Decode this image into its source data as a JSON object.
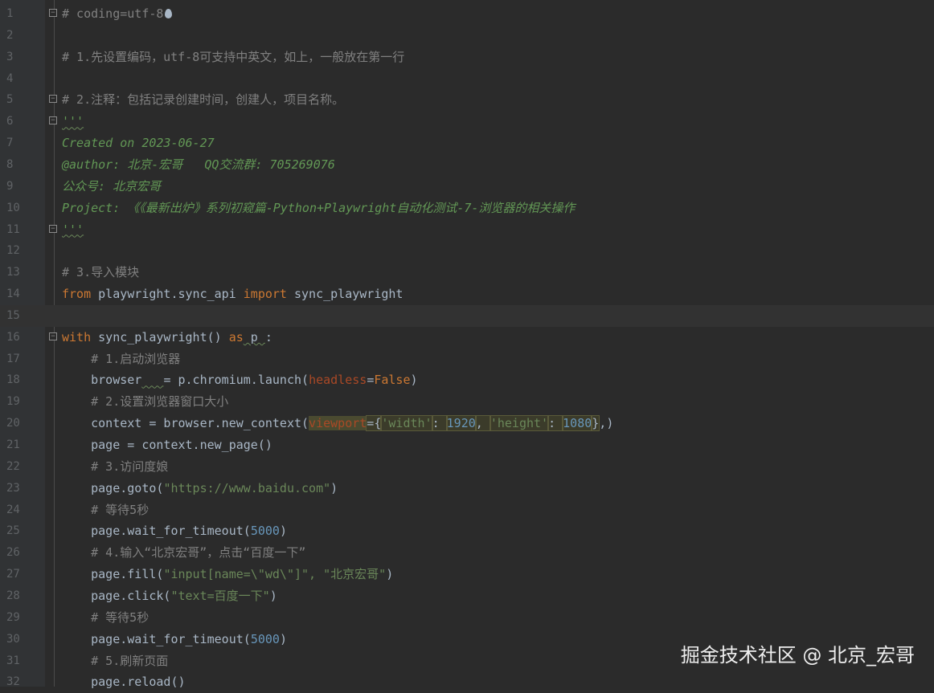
{
  "editor": {
    "lines": [
      {
        "n": "1",
        "segs": [
          [
            "t-comment",
            "# coding=utf-8"
          ]
        ],
        "fold": true,
        "drop": true
      },
      {
        "n": "2",
        "segs": []
      },
      {
        "n": "3",
        "segs": [
          [
            "t-comment",
            "# 1.先设置编码，utf-8可支持中英文，如上，一般放在第一行"
          ]
        ]
      },
      {
        "n": "4",
        "segs": []
      },
      {
        "n": "5",
        "segs": [
          [
            "t-comment",
            "# 2.注释：包括记录创建时间，创建人，项目名称。"
          ]
        ],
        "fold": true
      },
      {
        "n": "6",
        "segs": [
          [
            "t-doc squig",
            "'''"
          ]
        ],
        "fold": true
      },
      {
        "n": "7",
        "segs": [
          [
            "t-doc",
            "Created on 2023-06-27"
          ]
        ]
      },
      {
        "n": "8",
        "segs": [
          [
            "t-doc",
            "@author: 北京-宏哥   QQ交流群: 705269076"
          ]
        ]
      },
      {
        "n": "9",
        "segs": [
          [
            "t-doc",
            "公众号: 北京宏哥"
          ]
        ]
      },
      {
        "n": "10",
        "segs": [
          [
            "t-doc",
            "Project: 《《最新出炉》系列初窥篇-Python+Playwright自动化测试-7-浏览器的相关操作"
          ]
        ]
      },
      {
        "n": "11",
        "segs": [
          [
            "t-doc squig",
            "'''"
          ]
        ],
        "fold": true
      },
      {
        "n": "12",
        "segs": []
      },
      {
        "n": "13",
        "segs": [
          [
            "t-comment",
            "# 3.导入模块"
          ]
        ]
      },
      {
        "n": "14",
        "segs": [
          [
            "t-kw",
            "from"
          ],
          [
            "t-plain",
            " playwright.sync_api "
          ],
          [
            "t-kw",
            "import"
          ],
          [
            "t-plain",
            " sync_playwright"
          ]
        ]
      },
      {
        "n": "15",
        "segs": [],
        "current": true
      },
      {
        "n": "16",
        "segs": [
          [
            "t-kw",
            "with"
          ],
          [
            "t-plain",
            " sync_playwright() "
          ],
          [
            "t-kw",
            "as"
          ],
          [
            "t-plain squig",
            " p "
          ],
          [
            "t-plain",
            ":"
          ]
        ],
        "fold": true
      },
      {
        "n": "17",
        "segs": [
          [
            "t-comment",
            "    # 1.启动浏览器"
          ]
        ]
      },
      {
        "n": "18",
        "segs": [
          [
            "t-plain",
            "    browser"
          ],
          [
            "t-plain squig",
            "   "
          ],
          [
            "t-plain",
            "= p.chromium.launch("
          ],
          [
            "t-param",
            "headless"
          ],
          [
            "t-plain",
            "="
          ],
          [
            "t-kw",
            "False"
          ],
          [
            "t-plain",
            ")"
          ]
        ]
      },
      {
        "n": "19",
        "segs": [
          [
            "t-comment",
            "    # 2.设置浏览器窗口大小"
          ]
        ]
      },
      {
        "n": "20",
        "segs": [
          [
            "t-plain",
            "    context = browser.new_context("
          ],
          [
            "t-param hl2",
            "viewport"
          ],
          [
            "t-plain hl",
            "={"
          ],
          [
            "t-str hl",
            "'width'"
          ],
          [
            "t-plain hl",
            ": "
          ],
          [
            "t-num hl",
            "1920"
          ],
          [
            "t-plain hl",
            ", "
          ],
          [
            "t-str hl",
            "'height'"
          ],
          [
            "t-plain hl",
            ": "
          ],
          [
            "t-num hl",
            "1080"
          ],
          [
            "t-plain hl",
            "}"
          ],
          [
            "t-plain",
            ",)"
          ]
        ]
      },
      {
        "n": "21",
        "segs": [
          [
            "t-plain",
            "    page = context.new_page()"
          ]
        ]
      },
      {
        "n": "22",
        "segs": [
          [
            "t-comment",
            "    # 3.访问度娘"
          ]
        ]
      },
      {
        "n": "23",
        "segs": [
          [
            "t-plain",
            "    page.goto("
          ],
          [
            "t-str",
            "\"https://www.baidu.com\""
          ],
          [
            "t-plain",
            ")"
          ]
        ]
      },
      {
        "n": "24",
        "segs": [
          [
            "t-comment",
            "    # 等待5秒"
          ]
        ]
      },
      {
        "n": "25",
        "segs": [
          [
            "t-plain",
            "    page.wait_for_timeout("
          ],
          [
            "t-num",
            "5000"
          ],
          [
            "t-plain",
            ")"
          ]
        ]
      },
      {
        "n": "26",
        "segs": [
          [
            "t-comment",
            "    # 4.输入“北京宏哥”，点击“百度一下”"
          ]
        ]
      },
      {
        "n": "27",
        "segs": [
          [
            "t-plain",
            "    page.fill("
          ],
          [
            "t-str",
            "\"input[name=\\\"wd\\\"]\", \"北京宏哥\""
          ],
          [
            "t-plain",
            ")"
          ]
        ]
      },
      {
        "n": "28",
        "segs": [
          [
            "t-plain",
            "    page.click("
          ],
          [
            "t-str",
            "\"text=百度一下\""
          ],
          [
            "t-plain",
            ")"
          ]
        ]
      },
      {
        "n": "29",
        "segs": [
          [
            "t-comment",
            "    # 等待5秒"
          ]
        ]
      },
      {
        "n": "30",
        "segs": [
          [
            "t-plain",
            "    page.wait_for_timeout("
          ],
          [
            "t-num",
            "5000"
          ],
          [
            "t-plain",
            ")"
          ]
        ]
      },
      {
        "n": "31",
        "segs": [
          [
            "t-comment",
            "    # 5.刷新页面"
          ]
        ]
      },
      {
        "n": "32",
        "segs": [
          [
            "t-plain",
            "    page.reload()"
          ]
        ]
      }
    ]
  },
  "watermark": "掘金技术社区 @ 北京_宏哥"
}
